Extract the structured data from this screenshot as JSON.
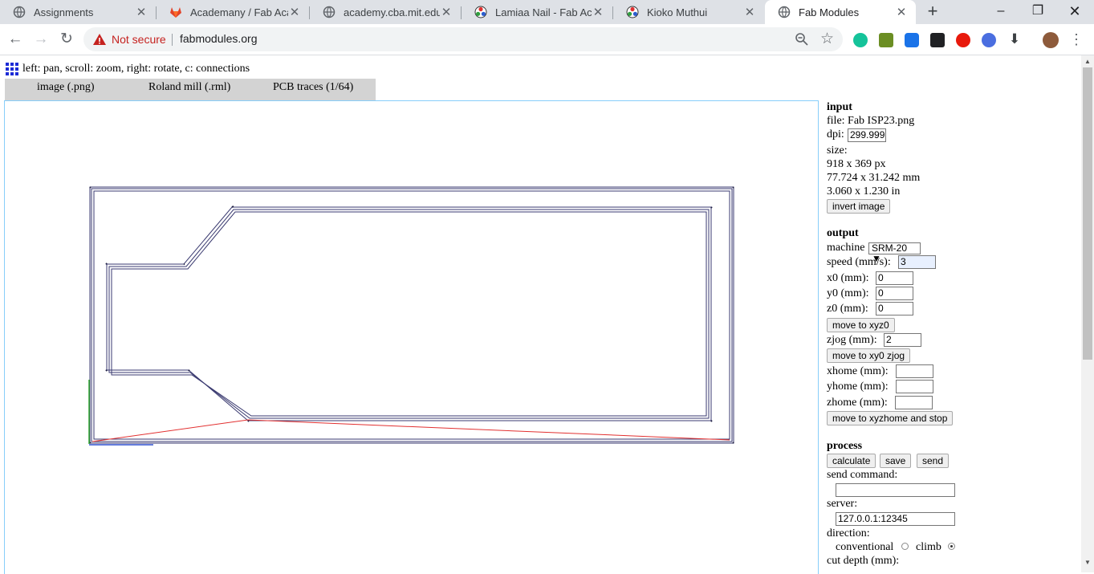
{
  "browser": {
    "tabs": [
      {
        "title": "Assignments",
        "icon": "globe-icon"
      },
      {
        "title": "Academany / Fab Acade",
        "icon": "gitlab-icon"
      },
      {
        "title": "academy.cba.mit.edu/cl",
        "icon": "globe-icon"
      },
      {
        "title": "Lamiaa Nail - Fab Acad",
        "icon": "fab-logo-icon"
      },
      {
        "title": "Kioko Muthui",
        "icon": "fab-logo-icon"
      },
      {
        "title": "Fab Modules",
        "icon": "globe-icon"
      }
    ],
    "security_label": "Not secure",
    "url": "fabmodules.org"
  },
  "page": {
    "hint": "left: pan, scroll: zoom, right: rotate, c: connections",
    "module_tabs": [
      "image (.png)",
      "Roland mill (.rml)",
      "PCB traces (1/64)"
    ]
  },
  "input": {
    "heading": "input",
    "file": "file: Fab ISP23.png",
    "dpi_label": "dpi:",
    "dpi": "299.999",
    "size_label": "size:",
    "size_px": "918 x 369 px",
    "size_mm": "77.724 x 31.242 mm",
    "size_in": "3.060 x 1.230 in",
    "invert_button": "invert image"
  },
  "output": {
    "heading": "output",
    "machine_label": "machine",
    "machine": "SRM-20",
    "speed_label": "speed (mm/s):",
    "speed": "3",
    "x0_label": "x0 (mm):",
    "x0": "0",
    "y0_label": "y0 (mm):",
    "y0": "0",
    "z0_label": "z0 (mm):",
    "z0": "0",
    "move_xyz0_button": "move to xyz0",
    "zjog_label": "zjog (mm):",
    "zjog": "2",
    "move_xy0_zjog_button": "move to xy0 zjog",
    "xhome_label": "xhome (mm):",
    "yhome_label": "yhome (mm):",
    "zhome_label": "zhome (mm):",
    "move_home_button": "move to xyzhome and stop"
  },
  "process": {
    "heading": "process",
    "calculate_button": "calculate",
    "save_button": "save",
    "send_button": "send",
    "send_command_label": "send command:",
    "send_command": "",
    "server_label": "server:",
    "server": "127.0.0.1:12345",
    "direction_label": "direction:",
    "conventional_label": "conventional",
    "climb_label": "climb",
    "direction_selected": "climb",
    "cut_depth_label": "cut depth (mm):"
  }
}
